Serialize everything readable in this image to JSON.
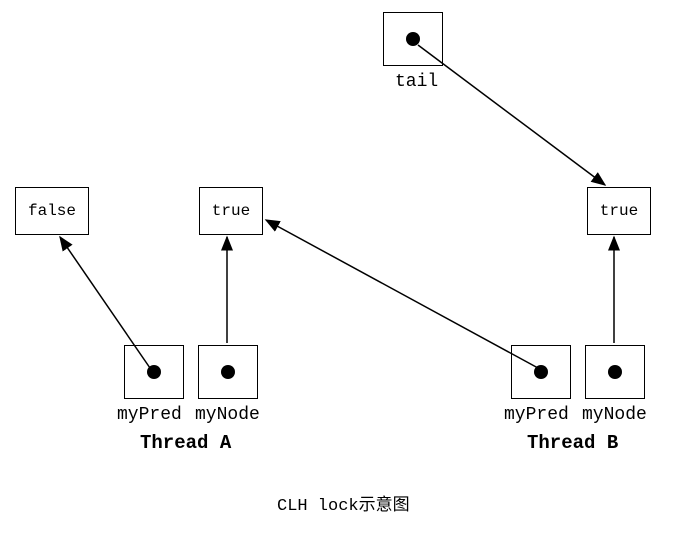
{
  "nodes": {
    "tail": {
      "label": "tail"
    },
    "false_box": {
      "value": "false"
    },
    "true_box_a": {
      "value": "true"
    },
    "true_box_b": {
      "value": "true"
    }
  },
  "thread_a": {
    "mypred_label": "myPred",
    "mynode_label": "myNode",
    "title": "Thread A"
  },
  "thread_b": {
    "mypred_label": "myPred",
    "mynode_label": "myNode",
    "title": "Thread B"
  },
  "caption": "CLH lock示意图",
  "chart_data": {
    "type": "diagram",
    "title": "CLH lock示意图",
    "description": "CLH lock schematic diagram showing queue node pointers",
    "entities": [
      {
        "id": "tail",
        "type": "pointer",
        "points_to": "node_b"
      },
      {
        "id": "node_false",
        "type": "qnode",
        "locked": false
      },
      {
        "id": "node_a",
        "type": "qnode",
        "locked": true
      },
      {
        "id": "node_b",
        "type": "qnode",
        "locked": true
      }
    ],
    "threads": [
      {
        "name": "Thread A",
        "myPred": "node_false",
        "myNode": "node_a"
      },
      {
        "name": "Thread B",
        "myPred": "node_a",
        "myNode": "node_b"
      }
    ],
    "edges": [
      {
        "from": "tail",
        "to": "node_b"
      },
      {
        "from": "ThreadA.myPred",
        "to": "node_false"
      },
      {
        "from": "ThreadA.myNode",
        "to": "node_a"
      },
      {
        "from": "ThreadB.myPred",
        "to": "node_a"
      },
      {
        "from": "ThreadB.myNode",
        "to": "node_b"
      }
    ]
  }
}
